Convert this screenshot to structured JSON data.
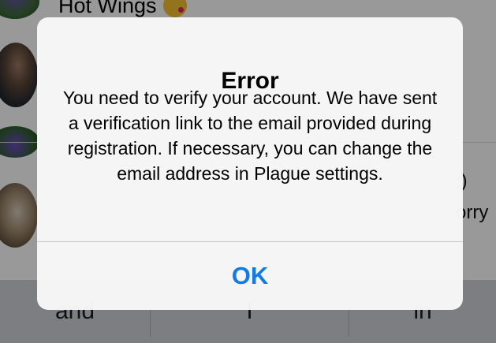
{
  "background": {
    "chat_title": "Hot Wings",
    "snippets": [
      ";)",
      "orry"
    ]
  },
  "keyboard": {
    "suggestions": [
      "and",
      "I",
      "in"
    ]
  },
  "alert": {
    "title": "Error",
    "message": "You need to verify your account. We have sent a verification link to the email provided during registration. If necessary, you can change the email address in Plague settings.",
    "button_label": "OK"
  },
  "colors": {
    "accent": "#127ae6",
    "overlay": "rgba(0,0,0,0.40)"
  }
}
